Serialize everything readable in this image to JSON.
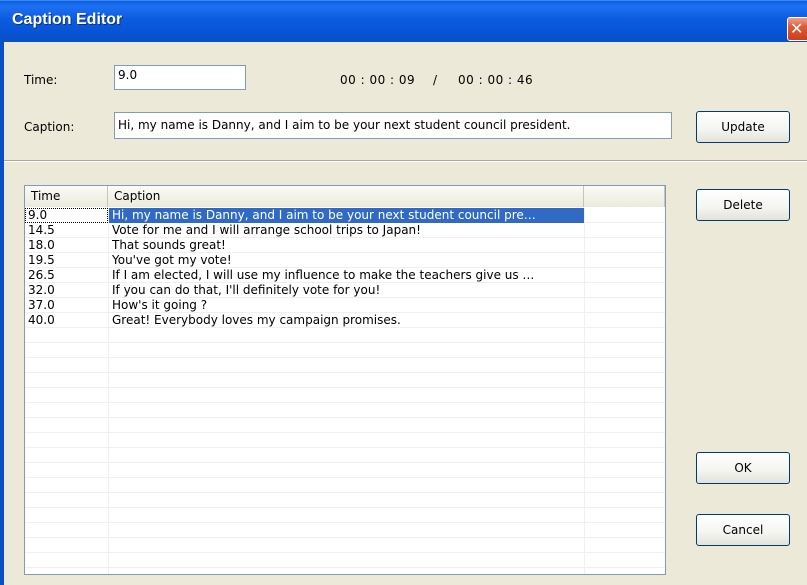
{
  "window": {
    "title": "Caption Editor",
    "close_glyph": "✕"
  },
  "form": {
    "time_label": "Time:",
    "time_value": "9.0",
    "current_time": "00 : 00 : 09",
    "separator": "/",
    "total_time": "00 : 00 : 46",
    "caption_label": "Caption:",
    "caption_value": "Hi, my name is Danny, and I aim to be your next student council president."
  },
  "buttons": {
    "update": "Update",
    "delete": "Delete",
    "ok": "OK",
    "cancel": "Cancel"
  },
  "list": {
    "columns": [
      "Time",
      "Caption"
    ],
    "selected_index": 0,
    "rows": [
      {
        "time": "9.0",
        "caption": "Hi, my name is Danny, and I aim to be your next student council pre…"
      },
      {
        "time": "14.5",
        "caption": "Vote for me and I will arrange school trips to Japan!"
      },
      {
        "time": "18.0",
        "caption": "That sounds great!"
      },
      {
        "time": "19.5",
        "caption": "You've got my vote!"
      },
      {
        "time": "26.5",
        "caption": "If I am elected, I will use my influence to make the teachers give us …"
      },
      {
        "time": "32.0",
        "caption": "If you can do that, I'll definitely vote for you!"
      },
      {
        "time": "37.0",
        "caption": "How's it going ?"
      },
      {
        "time": "40.0",
        "caption": "Great! Everybody loves my campaign promises."
      }
    ],
    "empty_rows": 16
  },
  "colors": {
    "titlebar": "#0A5FE0",
    "selection": "#316AC5",
    "dialog_bg": "#ECE9D8"
  }
}
